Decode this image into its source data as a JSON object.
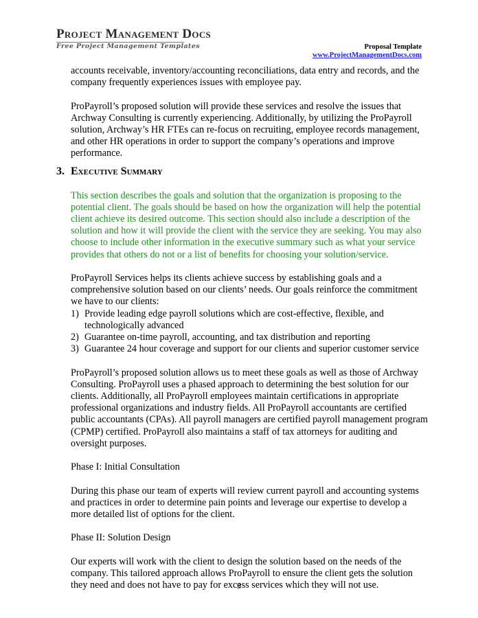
{
  "header": {
    "logo_title": "Project Management Docs",
    "logo_subtitle": "Free Project Management Templates",
    "doc_type": "Proposal Template",
    "site_link": "www.ProjectManagementDocs.com"
  },
  "content": {
    "para_continued": "accounts receivable, inventory/accounting reconciliations, data entry and records, and the company frequently experiences issues with employee pay.",
    "para_solution": "ProPayroll’s proposed solution will provide these services and resolve the issues that Archway Consulting is currently experiencing.  Additionally, by utilizing the ProPayroll solution, Archway’s HR FTEs can re-focus on recruiting, employee records management, and other HR operations in order to support the company’s operations and improve performance.",
    "section": {
      "number": "3.",
      "title": "Executive Summary"
    },
    "guidance": "This section describes the goals and solution that the organization is proposing to the potential client.  The goals should be based on how the organization will help the potential client achieve its desired outcome.  This section should also include a description of the solution and how it will provide the client with the service they are seeking.  You may also choose to include other information in the executive summary such as what your service provides that others do not or a list of benefits for choosing your solution/service.",
    "para_goals_intro": "ProPayroll Services helps its clients achieve success by establishing goals and a comprehensive solution based on our clients’ needs.  Our goals reinforce the commitment we have to our clients:",
    "goals": [
      {
        "n": "1)",
        "text": "Provide leading edge payroll solutions which are cost-effective, flexible, and technologically advanced"
      },
      {
        "n": "2)",
        "text": "Guarantee on-time payroll, accounting, and tax distribution and reporting"
      },
      {
        "n": "3)",
        "text": "Guarantee 24 hour coverage and support for our clients and superior customer service"
      }
    ],
    "para_approach": "ProPayroll’s proposed solution allows us to meet these goals as well as those of Archway Consulting.  ProPayroll uses a phased approach to determining the best solution for our clients.  Additionally, all ProPayroll employees maintain certifications in appropriate professional organizations and industry fields.  All ProPayroll accountants are certified public accountants (CPAs).  All payroll managers are certified payroll management program (CPMP) certified.  ProPayroll also maintains a staff of tax attorneys for auditing and oversight purposes.",
    "phase1_title": "Phase I: Initial Consultation",
    "phase1_text": "During this phase our team of experts will review current payroll and accounting systems and practices in order to determine pain points and leverage our expertise to develop a more detailed list of options for the client.",
    "phase2_title": "Phase II: Solution Design",
    "phase2_text": "Our experts will work with the client to design the solution based on the needs of the company.  This tailored approach allows ProPayroll to ensure the client gets the solution they need and does not have to pay for excess services which they will not use."
  },
  "footer": {
    "page_number": "3"
  }
}
